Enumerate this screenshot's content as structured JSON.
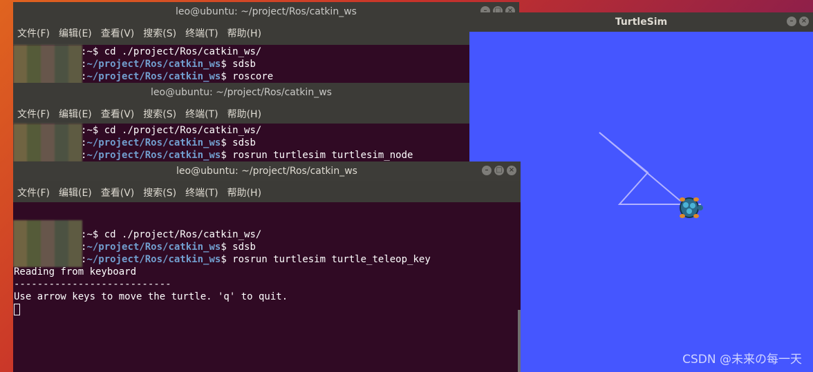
{
  "terminals": [
    {
      "title": "leo@ubuntu: ~/project/Ros/catkin_ws",
      "menu": [
        "文件(F)",
        "编辑(E)",
        "查看(V)",
        "搜索(S)",
        "终端(T)",
        "帮助(H)"
      ],
      "lines": [
        {
          "prompt_tail": "~$ ",
          "command": "cd ./project/Ros/catkin_ws/"
        },
        {
          "path": "~/project/Ros/catkin_ws",
          "dollar": "$ ",
          "command": "sdsb"
        },
        {
          "path": "~/project/Ros/catkin_ws",
          "dollar": "$ ",
          "command": "roscore"
        }
      ]
    },
    {
      "title": "leo@ubuntu: ~/project/Ros/catkin_ws",
      "menu": [
        "文件(F)",
        "编辑(E)",
        "查看(V)",
        "搜索(S)",
        "终端(T)",
        "帮助(H)"
      ],
      "lines": [
        {
          "prompt_tail": "~$ ",
          "command": "cd ./project/Ros/catkin_ws/"
        },
        {
          "path": "~/project/Ros/catkin_ws",
          "dollar": "$ ",
          "command": "sdsb"
        },
        {
          "path": "~/project/Ros/catkin_ws",
          "dollar": "$ ",
          "command": "rosrun turtlesim turtlesim_node"
        }
      ]
    },
    {
      "title": "leo@ubuntu: ~/project/Ros/catkin_ws",
      "menu": [
        "文件(F)",
        "编辑(E)",
        "查看(V)",
        "搜索(S)",
        "终端(T)",
        "帮助(H)"
      ],
      "lines": [
        {
          "prompt_tail": "~$ ",
          "command": "cd ./project/Ros/catkin_ws/"
        },
        {
          "path": "~/project/Ros/catkin_ws",
          "dollar": "$ ",
          "command": "sdsb"
        },
        {
          "path": "~/project/Ros/catkin_ws",
          "dollar": "$ ",
          "command": "rosrun turtlesim turtle_teleop_key"
        }
      ],
      "output": [
        "Reading from keyboard",
        "---------------------------",
        "Use arrow keys to move the turtle. 'q' to quit."
      ]
    }
  ],
  "window_controls": {
    "minimize": "–",
    "maximize": "□",
    "close": "×"
  },
  "turtlesim": {
    "title": "TurtleSim",
    "background_color": "#4556ff",
    "trail_color": "#b3b3ff"
  },
  "watermark": "CSDN @未来の每一天"
}
